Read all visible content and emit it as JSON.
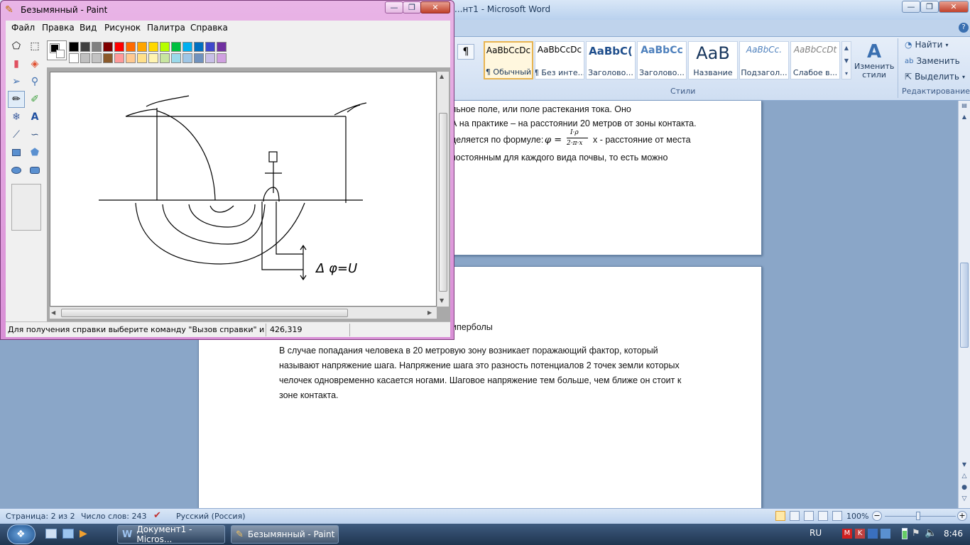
{
  "word": {
    "title": "...нт1 - Microsoft Word",
    "styles": [
      {
        "sample": "AaBbCcDc",
        "name": "¶ Обычный"
      },
      {
        "sample": "AaBbCcDc",
        "name": "¶ Без инте..."
      },
      {
        "sample": "AaBbC(",
        "name": "Заголово..."
      },
      {
        "sample": "AaBbCc",
        "name": "Заголово..."
      },
      {
        "sample": "AaB",
        "name": "Название"
      },
      {
        "sample": "AaBbCc.",
        "name": "Подзагол..."
      },
      {
        "sample": "AaBbCcDt",
        "name": "Слабое в..."
      }
    ],
    "change_styles": "Изменить стили",
    "styles_group": "Стили",
    "find": "Найти",
    "replace": "Заменить",
    "select": "Выделить",
    "editing_group": "Редактирование",
    "page1_lines": [
      "льное поле, или поле растекания тока. Оно",
      "А на практике – на расстоянии 20  метров от зоны контакта.",
      "деляется по формуле:",
      "x - расстояние от места",
      "постоянным для каждого вида  почвы, то есть можно"
    ],
    "formula_phi": "φ =",
    "formula_num": "I·ρ",
    "formula_den": "2·π·x",
    "page2_heading_fragment": "иперболы",
    "page2_lines": [
      "В случае попадания человека в 20  метровую зону возникает поражающий фактор, который",
      "называют напряжение шага. Напряжение шага это разность потенциалов 2 точек земли которых",
      "челочек одновременно касается ногами. Шаговое напряжение тем больше, чем ближе он стоит к",
      "зоне контакта."
    ],
    "status": {
      "page": "Страница: 2 из 2",
      "words": "Число слов: 243",
      "language": "Русский (Россия)",
      "zoom": "100%"
    }
  },
  "paint": {
    "title": "Безымянный - Paint",
    "menu": [
      "Файл",
      "Правка",
      "Вид",
      "Рисунок",
      "Палитра",
      "Справка"
    ],
    "status_help": "Для получения справки выберите команду \"Вызов справки\" из ме",
    "status_coords": "426,319",
    "palette_top": [
      "#000000",
      "#404040",
      "#808080",
      "#7f0000",
      "#ff0000",
      "#ff6a00",
      "#ffa500",
      "#ffd800",
      "#b6ff00",
      "#00c040",
      "#00b0f0",
      "#0070c0",
      "#3f48cc",
      "#7030a0"
    ],
    "palette_bottom": [
      "#ffffff",
      "#c0c0c0",
      "#c3c3c3",
      "#8b5a2b",
      "#ff9999",
      "#ffc990",
      "#ffe08a",
      "#fff4b0",
      "#c8e6a0",
      "#99d9ea",
      "#9ec6e6",
      "#7092be",
      "#c8bfe7",
      "#d0a0e0"
    ],
    "canvas_annotation": "Δ φ=U"
  },
  "taskbar": {
    "word_task": "Документ1 - Micros...",
    "paint_task": "Безымянный - Paint",
    "lang": "RU",
    "time": "8:46"
  }
}
